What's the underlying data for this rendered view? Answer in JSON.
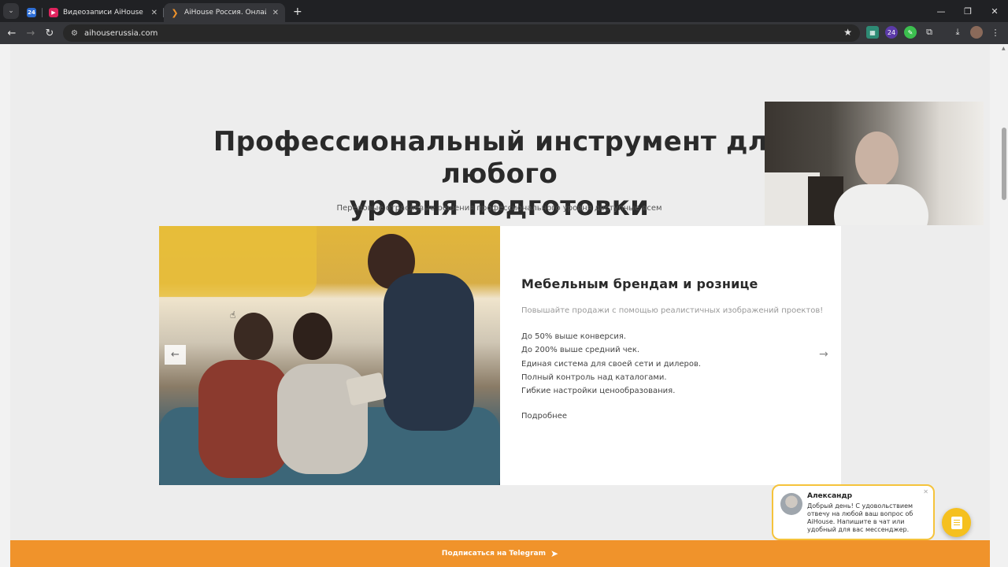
{
  "browser": {
    "tabs": [
      {
        "title": "",
        "favicon": "24"
      },
      {
        "title": "Видеозаписи AiHouse Россия",
        "favicon": "video-icon"
      },
      {
        "title": "AiHouse Россия. Онлайн-прог",
        "favicon": "aihouse-icon"
      }
    ],
    "url": "aihouserussia.com",
    "new_tab_symbol": "+",
    "window_controls": [
      "—",
      "❐",
      "✕"
    ],
    "extension_badge": "24"
  },
  "section": {
    "headline_line1": "Профессиональный инструмент для любого",
    "headline_line2": "уровня подготовки",
    "subline": "Передовые отраслевые решения профессионального уровня доступные всем"
  },
  "card": {
    "title": "Мебельным брендам и рознице",
    "lead": "Повышайте продажи с помощью реалистичных изображений проектов!",
    "bullets": [
      "До 50% выше конверсия.",
      "До 200% выше средний чек.",
      "Единая система для своей сети и дилеров.",
      "Полный контроль над каталогами.",
      "Гибкие настройки ценообразования."
    ],
    "more_link": "Подробнее"
  },
  "chat": {
    "name": "Александр",
    "message": "Добрый день! С удовольствием отвечу на любой ваш вопрос об AiHouse. Напишите в чат или удобный для вас мессенджер."
  },
  "telegram": {
    "label": "Подписаться на Telegram"
  },
  "colors": {
    "accent_orange": "#f0932b",
    "chat_yellow": "#f5c01f",
    "page_bg": "#ededed"
  }
}
